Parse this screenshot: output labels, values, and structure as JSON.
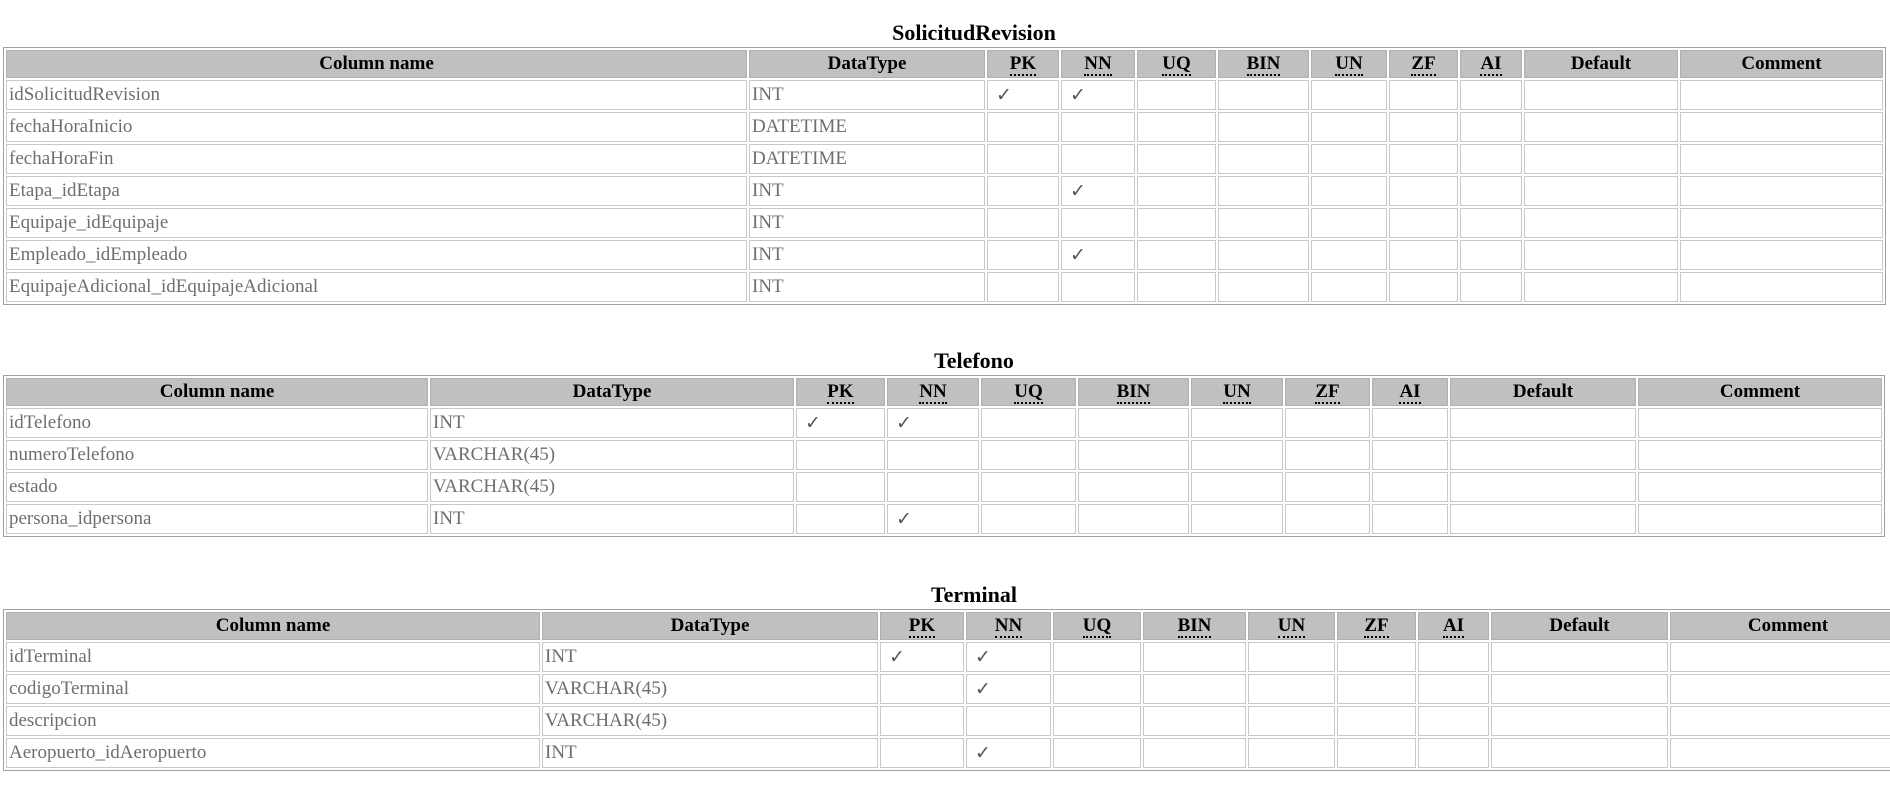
{
  "headers": {
    "column_name": "Column name",
    "datatype": "DataType",
    "pk": "PK",
    "nn": "NN",
    "uq": "UQ",
    "bin": "BIN",
    "un": "UN",
    "zf": "ZF",
    "ai": "AI",
    "default": "Default",
    "comment": "Comment"
  },
  "check_mark": "✓",
  "tables": [
    {
      "title": "SolicitudRevision",
      "rows": [
        {
          "name": "idSolicitudRevision",
          "type": "INT",
          "pk": "✓",
          "nn": "✓",
          "uq": "",
          "bin": "",
          "un": "",
          "zf": "",
          "ai": "",
          "default": "",
          "comment": ""
        },
        {
          "name": "fechaHoraInicio",
          "type": "DATETIME",
          "pk": "",
          "nn": "",
          "uq": "",
          "bin": "",
          "un": "",
          "zf": "",
          "ai": "",
          "default": "",
          "comment": ""
        },
        {
          "name": "fechaHoraFin",
          "type": "DATETIME",
          "pk": "",
          "nn": "",
          "uq": "",
          "bin": "",
          "un": "",
          "zf": "",
          "ai": "",
          "default": "",
          "comment": ""
        },
        {
          "name": "Etapa_idEtapa",
          "type": "INT",
          "pk": "",
          "nn": "✓",
          "uq": "",
          "bin": "",
          "un": "",
          "zf": "",
          "ai": "",
          "default": "",
          "comment": ""
        },
        {
          "name": "Equipaje_idEquipaje",
          "type": "INT",
          "pk": "",
          "nn": "",
          "uq": "",
          "bin": "",
          "un": "",
          "zf": "",
          "ai": "",
          "default": "",
          "comment": ""
        },
        {
          "name": "Empleado_idEmpleado",
          "type": "INT",
          "pk": "",
          "nn": "✓",
          "uq": "",
          "bin": "",
          "un": "",
          "zf": "",
          "ai": "",
          "default": "",
          "comment": ""
        },
        {
          "name": "EquipajeAdicional_idEquipajeAdicional",
          "type": "INT",
          "pk": "",
          "nn": "",
          "uq": "",
          "bin": "",
          "un": "",
          "zf": "",
          "ai": "",
          "default": "",
          "comment": ""
        }
      ]
    },
    {
      "title": "Telefono",
      "rows": [
        {
          "name": "idTelefono",
          "type": "INT",
          "pk": "✓",
          "nn": "✓",
          "uq": "",
          "bin": "",
          "un": "",
          "zf": "",
          "ai": "",
          "default": "",
          "comment": ""
        },
        {
          "name": "numeroTelefono",
          "type": "VARCHAR(45)",
          "pk": "",
          "nn": "",
          "uq": "",
          "bin": "",
          "un": "",
          "zf": "",
          "ai": "",
          "default": "",
          "comment": ""
        },
        {
          "name": "estado",
          "type": "VARCHAR(45)",
          "pk": "",
          "nn": "",
          "uq": "",
          "bin": "",
          "un": "",
          "zf": "",
          "ai": "",
          "default": "",
          "comment": ""
        },
        {
          "name": "persona_idpersona",
          "type": "INT",
          "pk": "",
          "nn": "✓",
          "uq": "",
          "bin": "",
          "un": "",
          "zf": "",
          "ai": "",
          "default": "",
          "comment": ""
        }
      ]
    },
    {
      "title": "Terminal",
      "rows": [
        {
          "name": "idTerminal",
          "type": "INT",
          "pk": "✓",
          "nn": "✓",
          "uq": "",
          "bin": "",
          "un": "",
          "zf": "",
          "ai": "",
          "default": "",
          "comment": ""
        },
        {
          "name": "codigoTerminal",
          "type": "VARCHAR(45)",
          "pk": "",
          "nn": "✓",
          "uq": "",
          "bin": "",
          "un": "",
          "zf": "",
          "ai": "",
          "default": "",
          "comment": ""
        },
        {
          "name": "descripcion",
          "type": "VARCHAR(45)",
          "pk": "",
          "nn": "",
          "uq": "",
          "bin": "",
          "un": "",
          "zf": "",
          "ai": "",
          "default": "",
          "comment": ""
        },
        {
          "name": "Aeropuerto_idAeropuerto",
          "type": "INT",
          "pk": "",
          "nn": "✓",
          "uq": "",
          "bin": "",
          "un": "",
          "zf": "",
          "ai": "",
          "default": "",
          "comment": ""
        }
      ]
    }
  ]
}
